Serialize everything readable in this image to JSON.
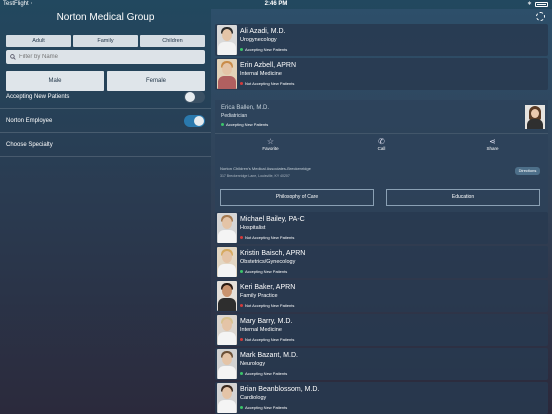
{
  "status_bar": {
    "carrier": "TestFlight",
    "time": "2:46 PM"
  },
  "left": {
    "title": "Norton Medical Group",
    "segments": [
      "Adult",
      "Family",
      "Children"
    ],
    "search": {
      "placeholder": "Filter by Name",
      "value": ""
    },
    "gender": [
      "Male",
      "Female"
    ],
    "filters": [
      {
        "label": "Accepting New Patients",
        "toggle": "off"
      },
      {
        "label": "Norton Employee",
        "toggle": "on"
      },
      {
        "label": "Choose Specialty"
      }
    ]
  },
  "doctors_top": [
    {
      "name": "Ali Azadi, M.D.",
      "specialty": "Urogynecology",
      "status": "Accepting New Patients",
      "status_color": "green"
    },
    {
      "name": "Erin Azbell, APRN",
      "specialty": "Internal Medicine",
      "status": "Not Accepting New Patients",
      "status_color": "red"
    }
  ],
  "expanded": {
    "name": "Erica Ballen, M.D.",
    "specialty": "Pediatrician",
    "status": "Accepting New Patients",
    "actions": [
      "Favorite",
      "Call",
      "Share"
    ],
    "practice": "Norton Children's Medical Associates-Breckenridge",
    "address": "317 Breckenridge Lane, Louisville, KY 40207",
    "directions": "Directions",
    "buttons": [
      "Philosophy of Care",
      "Education"
    ]
  },
  "doctors_bottom": [
    {
      "name": "Michael Bailey, PA-C",
      "specialty": "Hospitalist",
      "status": "Not Accepting New Patients",
      "status_color": "red"
    },
    {
      "name": "Kristin Baisch, APRN",
      "specialty": "Obstetrics/Gynecology",
      "status": "Accepting New Patients",
      "status_color": "green"
    },
    {
      "name": "Keri Baker, APRN",
      "specialty": "Family Practice",
      "status": "Not Accepting New Patients",
      "status_color": "red"
    },
    {
      "name": "Mary Barry, M.D.",
      "specialty": "Internal Medicine",
      "status": "Not Accepting New Patients",
      "status_color": "red"
    },
    {
      "name": "Mark Bazant, M.D.",
      "specialty": "Neurology",
      "status": "Accepting New Patients",
      "status_color": "green"
    },
    {
      "name": "Brian Beanblossom, M.D.",
      "specialty": "Cardiology",
      "status": "Accepting New Patients",
      "status_color": "green"
    }
  ]
}
